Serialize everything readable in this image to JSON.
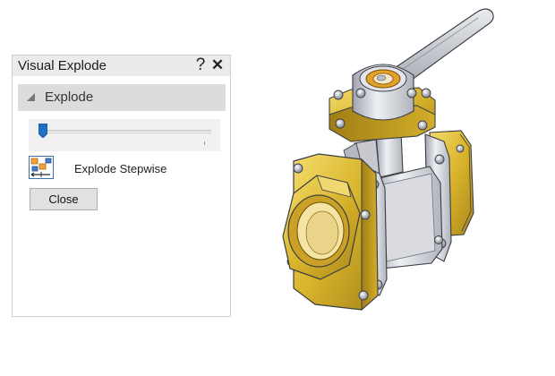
{
  "panel": {
    "title": "Visual Explode",
    "help_symbol": "?",
    "close_symbol": "✕"
  },
  "section": {
    "label": "Explode",
    "expanded": true
  },
  "slider": {
    "value": 0
  },
  "stepwise": {
    "label": "Explode Stepwise",
    "icon": "explode-stepwise-icon"
  },
  "close_button": {
    "label": "Close"
  },
  "colors": {
    "accent": "#1f6fc5",
    "brass": "#d7b52a",
    "steel": "#c9cbd1"
  },
  "model": {
    "icon": "ball-valve-model"
  }
}
